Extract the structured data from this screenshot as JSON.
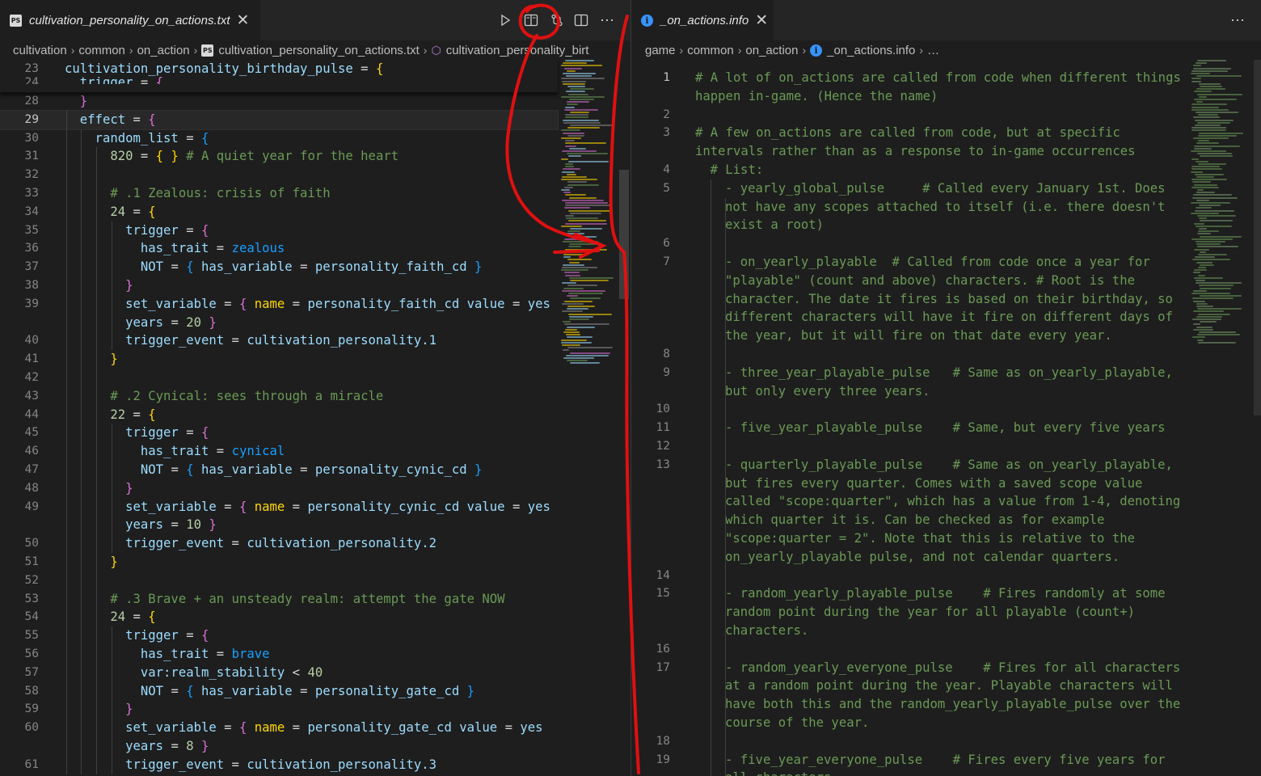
{
  "left_tab": {
    "file_icon": "ps-file-icon",
    "title": "cultivation_personality_on_actions.txt",
    "close_glyph": "✕"
  },
  "left_toolbar": {
    "run_icon": "play-icon",
    "split_icon": "open-preview-side-icon",
    "branch_icon": "compare-changes-icon",
    "layout_icon": "split-editor-icon",
    "more_glyph": "⋯"
  },
  "left_breadcrumb": [
    "cultivation",
    "common",
    "on_action",
    "cultivation_personality_on_actions.txt",
    "cultivation_personality_birt"
  ],
  "left_sticky": [
    {
      "ln": "23",
      "code": [
        {
          "t": "cultivation_personality_birthday_pulse",
          "c": "k"
        },
        {
          "t": " = ",
          "c": "o"
        },
        {
          "t": "{",
          "c": "b1"
        }
      ]
    },
    {
      "ln": "24",
      "code": [
        {
          "t": "  trigger",
          "c": "k"
        },
        {
          "t": " = ",
          "c": "o"
        },
        {
          "t": "{",
          "c": "b2"
        }
      ]
    }
  ],
  "left_lines": [
    {
      "ln": "28",
      "row": 0,
      "code": [
        {
          "t": "  ",
          "c": "o"
        },
        {
          "t": "}",
          "c": "b2"
        }
      ]
    },
    {
      "ln": "29",
      "row": 1,
      "current": true,
      "code": [
        {
          "t": "  effect",
          "c": "k"
        },
        {
          "t": " = ",
          "c": "o"
        },
        {
          "t": "{",
          "c": "b2"
        }
      ]
    },
    {
      "ln": "30",
      "row": 2,
      "code": [
        {
          "t": "    random_list",
          "c": "k"
        },
        {
          "t": " = ",
          "c": "o"
        },
        {
          "t": "{",
          "c": "b3"
        }
      ]
    },
    {
      "ln": "31",
      "row": 3,
      "code": [
        {
          "t": "      820",
          "c": "n"
        },
        {
          "t": " = ",
          "c": "o"
        },
        {
          "t": "{ }",
          "c": "b1"
        },
        {
          "t": " # A quiet year for the heart",
          "c": "c"
        }
      ]
    },
    {
      "ln": "32",
      "row": 4,
      "code": []
    },
    {
      "ln": "33",
      "row": 5,
      "code": [
        {
          "t": "      # .1 Zealous: crisis of faith",
          "c": "c"
        }
      ]
    },
    {
      "ln": "34",
      "row": 6,
      "code": [
        {
          "t": "      24",
          "c": "n"
        },
        {
          "t": " = ",
          "c": "o"
        },
        {
          "t": "{",
          "c": "b1"
        }
      ]
    },
    {
      "ln": "35",
      "row": 7,
      "code": [
        {
          "t": "        trigger",
          "c": "k"
        },
        {
          "t": " = ",
          "c": "o"
        },
        {
          "t": "{",
          "c": "b2"
        }
      ]
    },
    {
      "ln": "36",
      "row": 8,
      "code": [
        {
          "t": "          has_trait",
          "c": "k"
        },
        {
          "t": " = ",
          "c": "o"
        },
        {
          "t": "zealous",
          "c": "b3"
        }
      ]
    },
    {
      "ln": "37",
      "row": 9,
      "code": [
        {
          "t": "          NOT",
          "c": "k"
        },
        {
          "t": " = ",
          "c": "o"
        },
        {
          "t": "{",
          "c": "b3"
        },
        {
          "t": " has_variable",
          "c": "k"
        },
        {
          "t": " = ",
          "c": "o"
        },
        {
          "t": "personality_faith_cd",
          "c": "k"
        },
        {
          "t": " }",
          "c": "b3"
        }
      ]
    },
    {
      "ln": "38",
      "row": 10,
      "code": [
        {
          "t": "        ",
          "c": "o"
        },
        {
          "t": "}",
          "c": "b2"
        }
      ]
    },
    {
      "ln": "39",
      "row": 11,
      "code": [
        {
          "t": "        set_variable",
          "c": "k"
        },
        {
          "t": " = ",
          "c": "o"
        },
        {
          "t": "{",
          "c": "b2"
        },
        {
          "t": " name",
          "c": "b1"
        },
        {
          "t": " = ",
          "c": "o"
        },
        {
          "t": "personality_faith_cd",
          "c": "k"
        },
        {
          "t": " value",
          "c": "k"
        },
        {
          "t": " = ",
          "c": "o"
        },
        {
          "t": "yes",
          "c": "k"
        }
      ]
    },
    {
      "ln": "",
      "row": 12,
      "code": [
        {
          "t": "        years",
          "c": "k"
        },
        {
          "t": " = ",
          "c": "o"
        },
        {
          "t": "20",
          "c": "n"
        },
        {
          "t": " }",
          "c": "b2"
        }
      ]
    },
    {
      "ln": "40",
      "row": 13,
      "code": [
        {
          "t": "        trigger_event",
          "c": "k"
        },
        {
          "t": " = ",
          "c": "o"
        },
        {
          "t": "cultivation_personality.1",
          "c": "k"
        }
      ]
    },
    {
      "ln": "41",
      "row": 14,
      "code": [
        {
          "t": "      ",
          "c": "o"
        },
        {
          "t": "}",
          "c": "b1"
        }
      ]
    },
    {
      "ln": "42",
      "row": 15,
      "code": []
    },
    {
      "ln": "43",
      "row": 16,
      "code": [
        {
          "t": "      # .2 Cynical: sees through a miracle",
          "c": "c"
        }
      ]
    },
    {
      "ln": "44",
      "row": 17,
      "code": [
        {
          "t": "      22",
          "c": "n"
        },
        {
          "t": " = ",
          "c": "o"
        },
        {
          "t": "{",
          "c": "b1"
        }
      ]
    },
    {
      "ln": "45",
      "row": 18,
      "code": [
        {
          "t": "        trigger",
          "c": "k"
        },
        {
          "t": " = ",
          "c": "o"
        },
        {
          "t": "{",
          "c": "b2"
        }
      ]
    },
    {
      "ln": "46",
      "row": 19,
      "code": [
        {
          "t": "          has_trait",
          "c": "k"
        },
        {
          "t": " = ",
          "c": "o"
        },
        {
          "t": "cynical",
          "c": "b3"
        }
      ]
    },
    {
      "ln": "47",
      "row": 20,
      "code": [
        {
          "t": "          NOT",
          "c": "k"
        },
        {
          "t": " = ",
          "c": "o"
        },
        {
          "t": "{",
          "c": "b3"
        },
        {
          "t": " has_variable",
          "c": "k"
        },
        {
          "t": " = ",
          "c": "o"
        },
        {
          "t": "personality_cynic_cd",
          "c": "k"
        },
        {
          "t": " }",
          "c": "b3"
        }
      ]
    },
    {
      "ln": "48",
      "row": 21,
      "code": [
        {
          "t": "        ",
          "c": "o"
        },
        {
          "t": "}",
          "c": "b2"
        }
      ]
    },
    {
      "ln": "49",
      "row": 22,
      "code": [
        {
          "t": "        set_variable",
          "c": "k"
        },
        {
          "t": " = ",
          "c": "o"
        },
        {
          "t": "{",
          "c": "b2"
        },
        {
          "t": " name",
          "c": "b1"
        },
        {
          "t": " = ",
          "c": "o"
        },
        {
          "t": "personality_cynic_cd",
          "c": "k"
        },
        {
          "t": " value",
          "c": "k"
        },
        {
          "t": " = ",
          "c": "o"
        },
        {
          "t": "yes",
          "c": "k"
        }
      ]
    },
    {
      "ln": "",
      "row": 23,
      "code": [
        {
          "t": "        years",
          "c": "k"
        },
        {
          "t": " = ",
          "c": "o"
        },
        {
          "t": "10",
          "c": "n"
        },
        {
          "t": " }",
          "c": "b2"
        }
      ]
    },
    {
      "ln": "50",
      "row": 24,
      "code": [
        {
          "t": "        trigger_event",
          "c": "k"
        },
        {
          "t": " = ",
          "c": "o"
        },
        {
          "t": "cultivation_personality.2",
          "c": "k"
        }
      ]
    },
    {
      "ln": "51",
      "row": 25,
      "code": [
        {
          "t": "      ",
          "c": "o"
        },
        {
          "t": "}",
          "c": "b1"
        }
      ]
    },
    {
      "ln": "52",
      "row": 26,
      "code": []
    },
    {
      "ln": "53",
      "row": 27,
      "code": [
        {
          "t": "      # .3 Brave + an unsteady realm: attempt the gate NOW",
          "c": "c"
        }
      ]
    },
    {
      "ln": "54",
      "row": 28,
      "code": [
        {
          "t": "      24",
          "c": "n"
        },
        {
          "t": " = ",
          "c": "o"
        },
        {
          "t": "{",
          "c": "b1"
        }
      ]
    },
    {
      "ln": "55",
      "row": 29,
      "code": [
        {
          "t": "        trigger",
          "c": "k"
        },
        {
          "t": " = ",
          "c": "o"
        },
        {
          "t": "{",
          "c": "b2"
        }
      ]
    },
    {
      "ln": "56",
      "row": 30,
      "code": [
        {
          "t": "          has_trait",
          "c": "k"
        },
        {
          "t": " = ",
          "c": "o"
        },
        {
          "t": "brave",
          "c": "b3"
        }
      ]
    },
    {
      "ln": "57",
      "row": 31,
      "code": [
        {
          "t": "          var:realm_stability",
          "c": "k"
        },
        {
          "t": " < ",
          "c": "o"
        },
        {
          "t": "40",
          "c": "n"
        }
      ]
    },
    {
      "ln": "58",
      "row": 32,
      "code": [
        {
          "t": "          NOT",
          "c": "k"
        },
        {
          "t": " = ",
          "c": "o"
        },
        {
          "t": "{",
          "c": "b3"
        },
        {
          "t": " has_variable",
          "c": "k"
        },
        {
          "t": " = ",
          "c": "o"
        },
        {
          "t": "personality_gate_cd",
          "c": "k"
        },
        {
          "t": " }",
          "c": "b3"
        }
      ]
    },
    {
      "ln": "59",
      "row": 33,
      "code": [
        {
          "t": "        ",
          "c": "o"
        },
        {
          "t": "}",
          "c": "b2"
        }
      ]
    },
    {
      "ln": "60",
      "row": 34,
      "code": [
        {
          "t": "        set_variable",
          "c": "k"
        },
        {
          "t": " = ",
          "c": "o"
        },
        {
          "t": "{",
          "c": "b2"
        },
        {
          "t": " name",
          "c": "b1"
        },
        {
          "t": " = ",
          "c": "o"
        },
        {
          "t": "personality_gate_cd",
          "c": "k"
        },
        {
          "t": " value",
          "c": "k"
        },
        {
          "t": " = ",
          "c": "o"
        },
        {
          "t": "yes",
          "c": "k"
        }
      ]
    },
    {
      "ln": "",
      "row": 35,
      "code": [
        {
          "t": "        years",
          "c": "k"
        },
        {
          "t": " = ",
          "c": "o"
        },
        {
          "t": "8",
          "c": "n"
        },
        {
          "t": " }",
          "c": "b2"
        }
      ]
    },
    {
      "ln": "61",
      "row": 36,
      "code": [
        {
          "t": "        trigger_event",
          "c": "k"
        },
        {
          "t": " = ",
          "c": "o"
        },
        {
          "t": "cultivation_personality.3",
          "c": "k"
        }
      ]
    }
  ],
  "right_tab": {
    "file_icon": "info-file-icon",
    "title": "_on_actions.info",
    "close_glyph": "✕",
    "more_glyph": "⋯"
  },
  "right_breadcrumb": [
    "game",
    "common",
    "on_action",
    "_on_actions.info",
    "…"
  ],
  "right_lines": [
    {
      "ln": "1",
      "row": 0,
      "current": true,
      "indent": 0,
      "text": "# A lot of on_actions are called from code when different things"
    },
    {
      "ln": "",
      "row": 1,
      "indent": 0,
      "text": "happen in-game. (Hence the name)"
    },
    {
      "ln": "2",
      "row": 2,
      "indent": 0,
      "text": ""
    },
    {
      "ln": "3",
      "row": 3,
      "indent": 0,
      "text": "# A few on_actions are called from code, but at specific"
    },
    {
      "ln": "",
      "row": 4,
      "indent": 0,
      "text": "intervals rather than as a response to in-game occurrences"
    },
    {
      "ln": "4",
      "row": 5,
      "indent": 1,
      "text": "# List:"
    },
    {
      "ln": "5",
      "row": 6,
      "indent": 2,
      "text": "- yearly_global_pulse     # Called every January 1st. Does"
    },
    {
      "ln": "",
      "row": 7,
      "indent": 2,
      "text": "not have any scopes attached to itself (i.e. there doesn't"
    },
    {
      "ln": "",
      "row": 8,
      "indent": 2,
      "text": "exist a root)"
    },
    {
      "ln": "6",
      "row": 9,
      "indent": 0,
      "text": ""
    },
    {
      "ln": "7",
      "row": 10,
      "indent": 2,
      "text": "- on_yearly_playable  # Called from code once a year for"
    },
    {
      "ln": "",
      "row": 11,
      "indent": 2,
      "text": "\"playable\" (count and above) characters. # Root is the"
    },
    {
      "ln": "",
      "row": 12,
      "indent": 2,
      "text": "character. The date it fires is based on their birthday, so"
    },
    {
      "ln": "",
      "row": 13,
      "indent": 2,
      "text": "different characters will have it fire on different days of"
    },
    {
      "ln": "",
      "row": 14,
      "indent": 2,
      "text": "the year, but it will fire on that date every year."
    },
    {
      "ln": "8",
      "row": 15,
      "indent": 0,
      "text": ""
    },
    {
      "ln": "9",
      "row": 16,
      "indent": 2,
      "text": "- three_year_playable_pulse   # Same as on_yearly_playable,"
    },
    {
      "ln": "",
      "row": 17,
      "indent": 2,
      "text": "but only every three years."
    },
    {
      "ln": "10",
      "row": 18,
      "indent": 0,
      "text": ""
    },
    {
      "ln": "11",
      "row": 19,
      "indent": 2,
      "text": "- five_year_playable_pulse    # Same, but every five years"
    },
    {
      "ln": "12",
      "row": 20,
      "indent": 0,
      "text": ""
    },
    {
      "ln": "13",
      "row": 21,
      "indent": 2,
      "text": "- quarterly_playable_pulse    # Same as on_yearly_playable,"
    },
    {
      "ln": "",
      "row": 22,
      "indent": 2,
      "text": "but fires every quarter. Comes with a saved scope value"
    },
    {
      "ln": "",
      "row": 23,
      "indent": 2,
      "text": "called \"scope:quarter\", which has a value from 1-4, denoting"
    },
    {
      "ln": "",
      "row": 24,
      "indent": 2,
      "text": "which quarter it is. Can be checked as for example"
    },
    {
      "ln": "",
      "row": 25,
      "indent": 2,
      "text": "\"scope:quarter = 2\". Note that this is relative to the"
    },
    {
      "ln": "",
      "row": 26,
      "indent": 2,
      "text": "on_yearly_playable pulse, and not calendar quarters."
    },
    {
      "ln": "14",
      "row": 27,
      "indent": 0,
      "text": ""
    },
    {
      "ln": "15",
      "row": 28,
      "indent": 2,
      "text": "- random_yearly_playable_pulse    # Fires randomly at some"
    },
    {
      "ln": "",
      "row": 29,
      "indent": 2,
      "text": "random point during the year for all playable (count+)"
    },
    {
      "ln": "",
      "row": 30,
      "indent": 2,
      "text": "characters."
    },
    {
      "ln": "16",
      "row": 31,
      "indent": 0,
      "text": ""
    },
    {
      "ln": "17",
      "row": 32,
      "indent": 2,
      "text": "- random_yearly_everyone_pulse    # Fires for all characters"
    },
    {
      "ln": "",
      "row": 33,
      "indent": 2,
      "text": "at a random point during the year. Playable characters will"
    },
    {
      "ln": "",
      "row": 34,
      "indent": 2,
      "text": "have both this and the random_yearly_playable_pulse over the"
    },
    {
      "ln": "",
      "row": 35,
      "indent": 2,
      "text": "course of the year."
    },
    {
      "ln": "18",
      "row": 36,
      "indent": 0,
      "text": ""
    },
    {
      "ln": "19",
      "row": 37,
      "indent": 2,
      "text": "- five_year_everyone_pulse    # Fires every five years for"
    },
    {
      "ln": "",
      "row": 38,
      "indent": 2,
      "text": "all characters."
    }
  ],
  "colors": {
    "editor_bg": "#1e1e1e",
    "keyword": "#9cdcfe",
    "comment": "#6a9955",
    "number": "#b5cea8",
    "bracket_gold": "#ffd700",
    "bracket_pink": "#da70d6",
    "bracket_blue": "#179fff",
    "annotation_red": "#e01010"
  }
}
